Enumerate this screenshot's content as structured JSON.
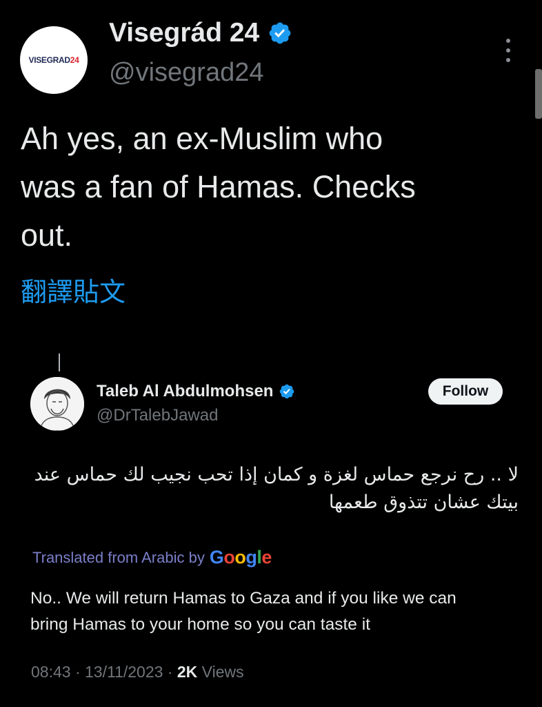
{
  "author": {
    "avatar_text_main": "VISEGRAD",
    "avatar_text_num": "24",
    "display_name": "Visegrád 24",
    "handle": "@visegrad24"
  },
  "tweet": {
    "text": "Ah yes, an ex-Muslim who\nwas a fan of Hamas. Checks\nout.",
    "translate_label": "翻譯貼文"
  },
  "quoted": {
    "display_name": "Taleb Al Abdulmohsen",
    "handle": "@DrTalebJawad",
    "follow_label": "Follow",
    "arabic_text": "لا .. رح نرجع حماس لغزة و كمان إذا تحب نجيب لك حماس عند بيتك عشان تتذوق طعمها",
    "translated_from": "Translated from Arabic by",
    "google_letters": [
      "G",
      "o",
      "o",
      "g",
      "l",
      "e"
    ],
    "translation": "No.. We will return Hamas to Gaza and if you like we can\nbring Hamas to your home so you can taste it"
  },
  "meta": {
    "time": "08:43",
    "date": "13/11/2023",
    "views_count": "2K",
    "views_label": "Views",
    "sep": "·"
  },
  "colors": {
    "verified": "#1d9bf0",
    "link": "#1d9bf0",
    "background": "#000000"
  },
  "icons": {
    "verified": "verified-badge-icon",
    "more": "more-options-icon"
  }
}
